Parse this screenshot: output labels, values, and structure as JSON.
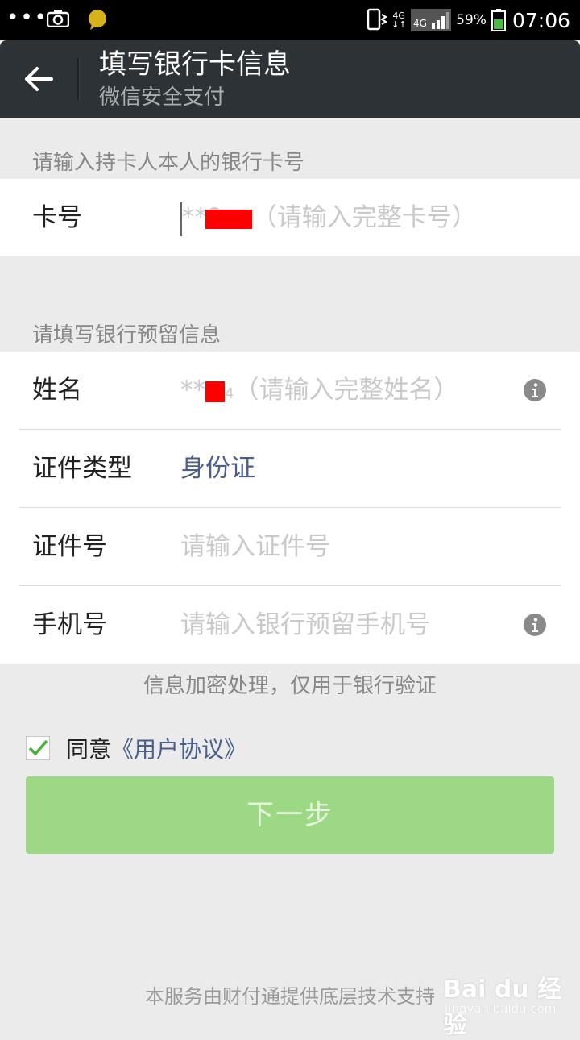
{
  "status_bar": {
    "network_small": "4G",
    "network": "4G",
    "battery": "59%",
    "time": "07:06"
  },
  "header": {
    "title": "填写银行卡信息",
    "subtitle": "微信安全支付"
  },
  "section1": {
    "label": "请输入持卡人本人的银行卡号",
    "card": {
      "label": "卡号",
      "prefix": "**9",
      "placeholder": "（请输入完整卡号）"
    }
  },
  "section2": {
    "label": "请填写银行预留信息",
    "name": {
      "label": "姓名",
      "prefix": "**",
      "suffix": "4",
      "placeholder": "（请输入完整姓名）"
    },
    "id_type": {
      "label": "证件类型",
      "value": "身份证"
    },
    "id_number": {
      "label": "证件号",
      "placeholder": "请输入证件号"
    },
    "phone": {
      "label": "手机号",
      "placeholder": "请输入银行预留手机号"
    }
  },
  "hint": "信息加密处理，仅用于银行验证",
  "agreement": {
    "checked": true,
    "text": "同意",
    "link": "《用户协议》"
  },
  "next_button": "下一步",
  "footer": "本服务由财付通提供底层技术支持",
  "watermark": {
    "brand": "Bai du 经验",
    "url": "jingyan.baidu.com"
  },
  "colors": {
    "header_bg": "#2c3235",
    "link_blue": "#4a5f8a",
    "button_green": "#9dd884",
    "redaction": "#ff0000"
  }
}
